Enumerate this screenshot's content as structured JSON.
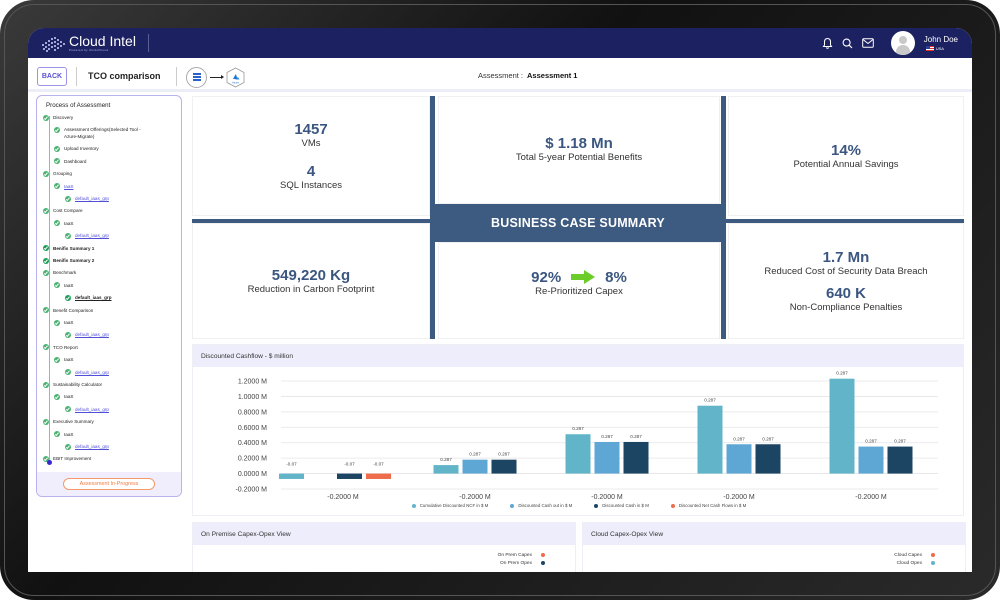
{
  "app": {
    "logo_name": "Cloud Intel",
    "logo_tagline": "Powered by Click2Cloud"
  },
  "user": {
    "name": "John Doe",
    "country": "USA"
  },
  "header": {
    "back_label": "BACK",
    "page_title": "TCO comparison",
    "source_label": "On-Premise",
    "target_label": "Azure",
    "assessment_label": "Assessment :",
    "assessment_value": "Assessment 1"
  },
  "sidebar": {
    "title": "Process of Assessment",
    "status": "Assessment In-Progress",
    "steps": [
      {
        "label": "Discovery",
        "level": 0
      },
      {
        "label": "Assessment Offerings(Selected Tool - Azure-Migrate)",
        "level": 1
      },
      {
        "label": "Upload Inventory",
        "level": 1
      },
      {
        "label": "Dashboard",
        "level": 1
      },
      {
        "label": "Grouping",
        "level": 0
      },
      {
        "label": "IaaS",
        "level": 1,
        "link": true
      },
      {
        "label": "default_iaas_grp",
        "level": 2,
        "link": true
      },
      {
        "label": "Cost Compare",
        "level": 0
      },
      {
        "label": "IaaS",
        "level": 1
      },
      {
        "label": "default_iaas_grp",
        "level": 2,
        "link": true
      },
      {
        "label": "Benifis Summary 1",
        "level": 0,
        "bold": true
      },
      {
        "label": "Benifis Summary 2",
        "level": 0,
        "bold": true
      },
      {
        "label": "Benchmark",
        "level": 0
      },
      {
        "label": "IaaS",
        "level": 1
      },
      {
        "label": "default_iaas_grp",
        "level": 2,
        "bold": true,
        "underline": true
      },
      {
        "label": "Benefit Comparison",
        "level": 0
      },
      {
        "label": "IaaS",
        "level": 1
      },
      {
        "label": "default_iaas_grp",
        "level": 2,
        "link": true
      },
      {
        "label": "TCO Report",
        "level": 0
      },
      {
        "label": "IaaS",
        "level": 1
      },
      {
        "label": "default_iaas_grp",
        "level": 2,
        "link": true
      },
      {
        "label": "Sustainability Calculator",
        "level": 0
      },
      {
        "label": "IaaS",
        "level": 1
      },
      {
        "label": "default_iaas_grp",
        "level": 2,
        "link": true
      },
      {
        "label": "Executive Summary",
        "level": 0
      },
      {
        "label": "IaaS",
        "level": 1
      },
      {
        "label": "default_iaas_grp",
        "level": 2,
        "link": true
      },
      {
        "label": "EBIT Improvement",
        "level": 0
      }
    ]
  },
  "summary": {
    "banner": "BUSINESS CASE SUMMARY",
    "vms_value": "1457",
    "vms_label": "VMs",
    "sql_value": "4",
    "sql_label": "SQL Instances",
    "benefits_value": "$ 1.18 Mn",
    "benefits_label": "Total 5-year Potential Benefits",
    "savings_value": "14%",
    "savings_label": "Potential Annual Savings",
    "carbon_value": "549,220 Kg",
    "carbon_label": "Reduction in Carbon Footprint",
    "capex_from": "92%",
    "capex_to": "8%",
    "capex_label": "Re-Prioritized Capex",
    "breach_value": "1.7 Mn",
    "breach_label": "Reduced Cost of Security Data Breach",
    "penalty_value": "640 K",
    "penalty_label": "Non-Compliance Penalties"
  },
  "chart_data": {
    "type": "bar",
    "title": "Discounted Cashflow - $ million",
    "xlabel": "",
    "ylabel": "",
    "ylim": [
      -0.2,
      1.2
    ],
    "yticks": [
      1.2,
      1.0,
      0.8,
      0.6,
      0.4,
      0.2,
      0.0,
      -0.2
    ],
    "ytick_labels": [
      "1.2000 M",
      "1.0000 M",
      "0.8000 M",
      "0.6000 M",
      "0.4000 M",
      "0.2000 M",
      "0.0000 M",
      "-0.2000 M"
    ],
    "categories": [
      "-0.2000 M",
      "-0.2000 M",
      "-0.2000 M",
      "-0.2000 M",
      "-0.2000 M"
    ],
    "grid": true,
    "legend_position": "bottom",
    "series": [
      {
        "name": "Cumulative Discounted NCF in $ M",
        "color": "#62b5c9",
        "values": [
          -0.07,
          0.11,
          0.51,
          0.88,
          1.23
        ],
        "labels": [
          "-0.07",
          "0.287",
          "0.287",
          "0.287",
          "0.287"
        ]
      },
      {
        "name": "Discounted Cash out in $ M",
        "color": "#5ea7d5",
        "values": [
          null,
          0.18,
          0.41,
          0.38,
          0.35
        ],
        "labels": [
          "",
          "0.287",
          "0.287",
          "0.287",
          "0.287"
        ]
      },
      {
        "name": "Discounted Cash in $ M",
        "color": "#1b4563",
        "values": [
          -0.07,
          0.18,
          0.41,
          0.38,
          0.35
        ],
        "labels": [
          "-0.07",
          "0.287",
          "0.287",
          "0.287",
          "0.287"
        ]
      },
      {
        "name": "Discounted Net Cash Flows in $ M",
        "color": "#ee6b4c",
        "values": [
          -0.07,
          null,
          null,
          null,
          null
        ],
        "labels": [
          "-0.07",
          "",
          "",
          "",
          ""
        ]
      }
    ]
  },
  "onprem": {
    "title": "On Premise Capex-Opex View",
    "legend": [
      {
        "label": "On Prem Capex",
        "color": "#ee6b4c"
      },
      {
        "label": "On Prem Opex",
        "color": "#1b4563"
      }
    ]
  },
  "cloud": {
    "title": "Cloud Capex-Opex View",
    "legend": [
      {
        "label": "Cloud Capex",
        "color": "#ee6b4c"
      },
      {
        "label": "Cloud Opex",
        "color": "#62b5c9"
      }
    ]
  }
}
